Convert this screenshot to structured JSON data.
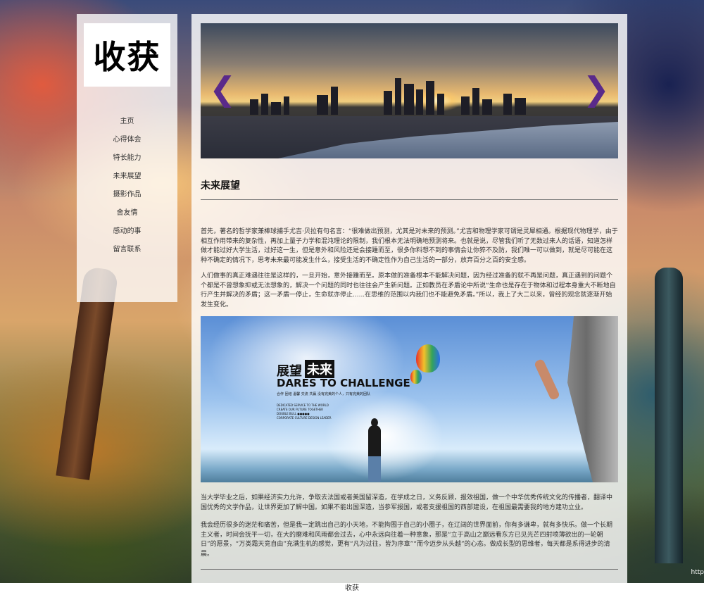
{
  "site": {
    "logo": "收获"
  },
  "sidebar": {
    "items": [
      {
        "label": "主页"
      },
      {
        "label": "心得体会"
      },
      {
        "label": "特长能力"
      },
      {
        "label": "未来展望"
      },
      {
        "label": "摄影作品"
      },
      {
        "label": "舍友情"
      },
      {
        "label": "感动的事"
      },
      {
        "label": "留言联系"
      }
    ]
  },
  "carousel": {
    "prev_icon": "chevron-left-icon",
    "next_icon": "chevron-right-icon"
  },
  "main": {
    "title": "未来展望",
    "paragraphs": [
      "首先，著名的哲学家兼棒球捕手尤吉·贝拉有句名言：“很难做出预测，尤其是对未来的预测。”尤吉和物理学家可谓是灵犀相通。根据现代物理学，由于相互作用带来的复杂性，再加上量子力学和混沌理论的限制，我们根本无法明确地预测将来。也就是说，尽管我们听了无数过来人的话语，知道怎样做才能过好大学生活，过好这一生，但是意外和风险还是会接踵而至，很多你料想不到的事情会让你猝不及防，我们唯一可以做到，就是尽可能在这种不确定的情况下，思考未来最可能发生什么，接受生活的不确定性作为自己生活的一部分，放弃百分之百的安全感。",
      "人们做事的真正难遇往往是这样的，一旦开始，意外接踵而至。原本做的准备根本不能解决问题，因为经过准备的就不再是问题，真正遇到的问题个个都是不曾想象抑或无法想象的，解决一个问题的同时也往往会产生新问题。正如教员在矛盾论中所说“生命也是存在于物体和过程本身重大不断地自行产生并解决的矛盾；这一矛盾一停止，生命就亦停止......在思维的范围以内我们也不能避免矛盾。”所以，我上了大二以来，曾经的观念就逐渐开始发生变化。",
      "当大学毕业之后，如果经济实力允许，争取去法国或者美国留深造，在学成之日，义务反顾，报效祖国，做一个中华优秀传统文化的传播者，翻译中国优秀的文学作品，让世界更加了解中国。如果不能出国深造，当参军报国，或者支援祖国的西部建设，在祖国最需要我的地方建功立业。",
      "我会经历很多的迷茫和痛苦，但是我一定跳出自己的小天地，不能拘囿于自己的小圈子，在辽阔的世界面前，你有多谦卑，就有多快乐。做一个长期主义者，时间会抚平一切，在大的磨难和风雨都会过去，心中永远向往着一种意象，那是“立于高山之巅远看东方已见光芒四射喷薄欲出的一轮朝日”的愿景，“万类霜天竞自由”充满生机的感觉，更有“凡为过往，皆为序章”“而今迈步从头越”的心态。做成长型的思维者，每天都是系得进步的清晨。"
    ]
  },
  "poster": {
    "title_a": "展望",
    "title_b": "未来",
    "subtitle": "DARES TO CHALLENGE",
    "tagline": "合作  团结  温馨  交流  共赢      没有完美的个人，只有完美的团队",
    "small_1": "DEDICATED SERVICE TO THE WORLD",
    "small_2": "CREATE OUR FUTURE TOGETHER",
    "small_3": "DOUBLE BULL   ●●●●●",
    "small_4": "CORPORATE CULTURE DESIGN LEADER"
  },
  "footer": {
    "text": "收获"
  },
  "corner": {
    "text": "http"
  }
}
